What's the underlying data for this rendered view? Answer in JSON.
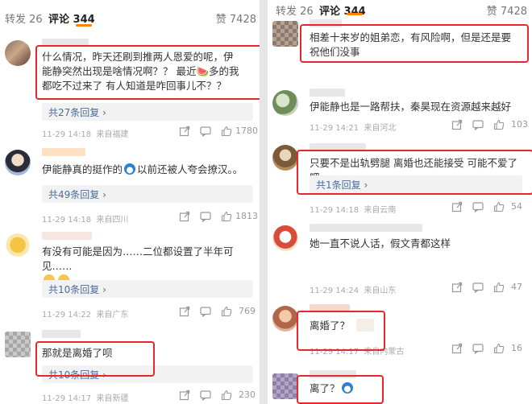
{
  "left": {
    "tabs": {
      "repost": "转发 26",
      "comments": "评论 344",
      "likes": "赞 7428"
    },
    "comments": [
      {
        "text": "什么情况，昨天还刷到推两人恩爱的呢，伊能静突然出现是啥情况啊？？ 最近🍉多的我都吃不过来了 有人知道是咋回事儿不？？",
        "reply": "共27条回复 ›",
        "time": "11-29 14:18",
        "loc": "来自福建",
        "likes": "1780"
      },
      {
        "text": "伊能静真的挺作的",
        "text2": "以前还被人夸会撩汉。。",
        "reply": "共49条回复 ›",
        "time": "11-29 14:18",
        "loc": "来自四川",
        "likes": "1813"
      },
      {
        "text": "有没有可能是因为……二位都设置了半年可见……",
        "reply": "共10条回复 ›",
        "time": "11-29 14:22",
        "loc": "来自广东",
        "likes": "769"
      },
      {
        "text": "那就是离婚了呗",
        "reply": "共10条回复 ›",
        "time": "11-29 14:17",
        "loc": "来自新疆",
        "likes": "230"
      }
    ]
  },
  "right": {
    "tabs": {
      "repost": "转发 26",
      "comments": "评论 344",
      "likes": "赞 7428"
    },
    "comments": [
      {
        "text": "相差十来岁的姐弟恋，有风险啊，但是还是要祝他们没事"
      },
      {
        "text": "伊能静也是一路帮扶，秦昊现在资源越来越好",
        "time": "11-29 14:21",
        "loc": "来自河北",
        "likes": "103"
      },
      {
        "text": "只要不是出轨劈腿 离婚也还能接受 可能不爱了吧",
        "reply": "共1条回复 ›",
        "time": "11-29 14:18",
        "loc": "来自云南",
        "likes": "54"
      },
      {
        "text": "她一直不说人话，假文青都这样",
        "time": "11-29 14:24",
        "loc": "来自山东",
        "likes": "47"
      },
      {
        "text": "离婚了？",
        "time": "11-29 14:17",
        "loc": "来自内蒙古",
        "likes": "16"
      },
      {
        "text": "离了？"
      }
    ]
  },
  "colors": {
    "accent": "#ff8200",
    "highlight": "#e8262c",
    "link": "#4a6e9b"
  }
}
